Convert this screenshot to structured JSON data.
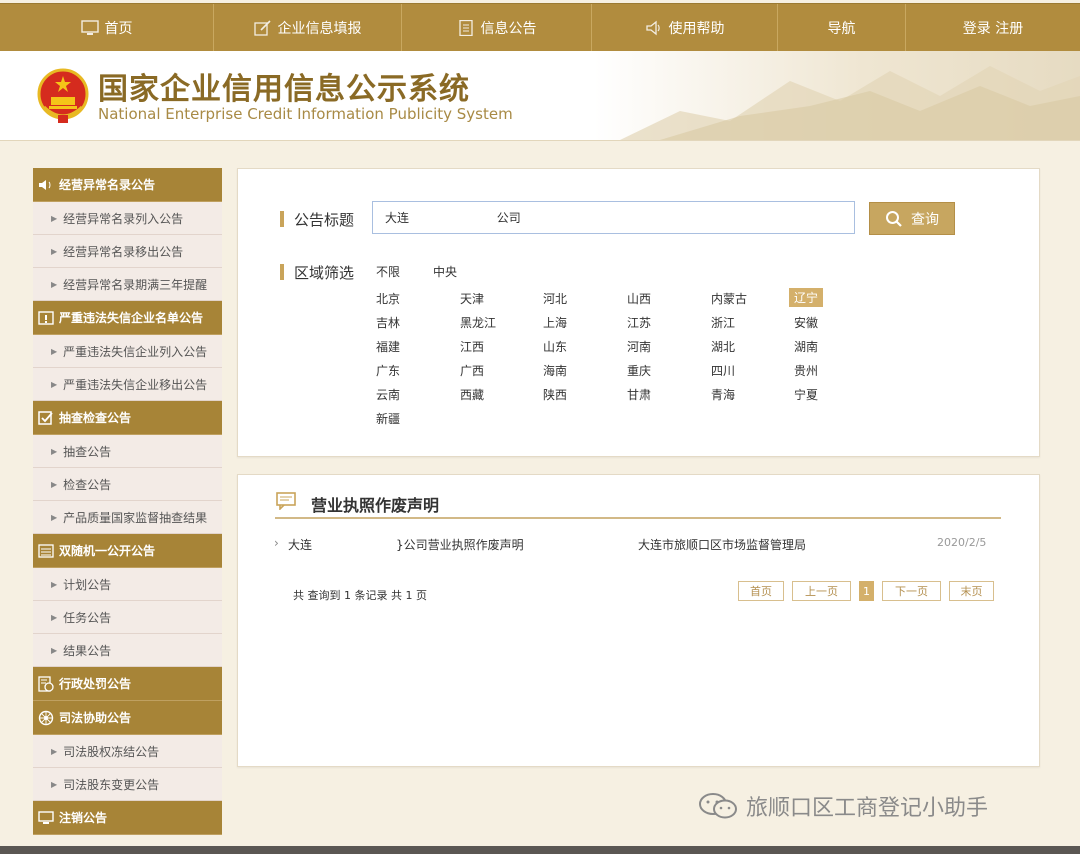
{
  "nav": {
    "items": [
      {
        "label": "首页",
        "icon": "monitor-icon"
      },
      {
        "label": "企业信息填报",
        "icon": "edit-icon"
      },
      {
        "label": "信息公告",
        "icon": "document-icon"
      },
      {
        "label": "使用帮助",
        "icon": "speaker-icon"
      },
      {
        "label": "导航",
        "icon": ""
      },
      {
        "label": "登录 注册",
        "icon": ""
      }
    ]
  },
  "header": {
    "title_cn": "国家企业信用信息公示系统",
    "title_en": "National Enterprise Credit Information Publicity System"
  },
  "sidebar": {
    "groups": [
      {
        "title": "经营异常名录公告",
        "icon": "speaker-icon",
        "items": [
          "经营异常名录列入公告",
          "经营异常名录移出公告",
          "经营异常名录期满三年提醒"
        ]
      },
      {
        "title": "严重违法失信企业名单公告",
        "icon": "warning-board-icon",
        "items": [
          "严重违法失信企业列入公告",
          "严重违法失信企业移出公告"
        ]
      },
      {
        "title": "抽查检查公告",
        "icon": "checkbox-icon",
        "items": [
          "抽查公告",
          "检查公告",
          "产品质量国家监督抽查结果"
        ]
      },
      {
        "title": "双随机一公开公告",
        "icon": "list-icon",
        "items": [
          "计划公告",
          "任务公告",
          "结果公告"
        ]
      },
      {
        "title": "行政处罚公告",
        "icon": "penalty-icon",
        "items": []
      },
      {
        "title": "司法协助公告",
        "icon": "wheel-icon",
        "items": [
          "司法股权冻结公告",
          "司法股东变更公告"
        ]
      },
      {
        "title": "注销公告",
        "icon": "monitor-icon",
        "items": []
      }
    ]
  },
  "search": {
    "label": "公告标题",
    "value": "大连                       公司",
    "button": "查询"
  },
  "region": {
    "label": "区域筛选",
    "top": [
      "不限",
      "中央"
    ],
    "rows": [
      [
        "北京",
        "天津",
        "河北",
        "山西",
        "内蒙古",
        "辽宁"
      ],
      [
        "吉林",
        "黑龙江",
        "上海",
        "江苏",
        "浙江",
        "安徽"
      ],
      [
        "福建",
        "江西",
        "山东",
        "河南",
        "湖北",
        "湖南"
      ],
      [
        "广东",
        "广西",
        "海南",
        "重庆",
        "四川",
        "贵州"
      ],
      [
        "云南",
        "西藏",
        "陕西",
        "甘肃",
        "青海",
        "宁夏"
      ],
      [
        "新疆"
      ]
    ],
    "active": "辽宁"
  },
  "results": {
    "title": "营业执照作废声明",
    "rows": [
      {
        "name_prefix": "大连",
        "name_suffix": "}公司营业执照作废声明",
        "authority": "大连市旅顺口区市场监督管理局",
        "date": "2020/2/5"
      }
    ],
    "summary": "共 查询到 1 条记录 共 1 页",
    "pager": {
      "first": "首页",
      "prev": "上一页",
      "current": "1",
      "next": "下一页",
      "last": "末页"
    }
  },
  "watermark": "旅顺口区工商登记小助手",
  "colors": {
    "gold": "#b18c3e",
    "sidebar_header": "#a78437",
    "accent": "#c7a660"
  }
}
